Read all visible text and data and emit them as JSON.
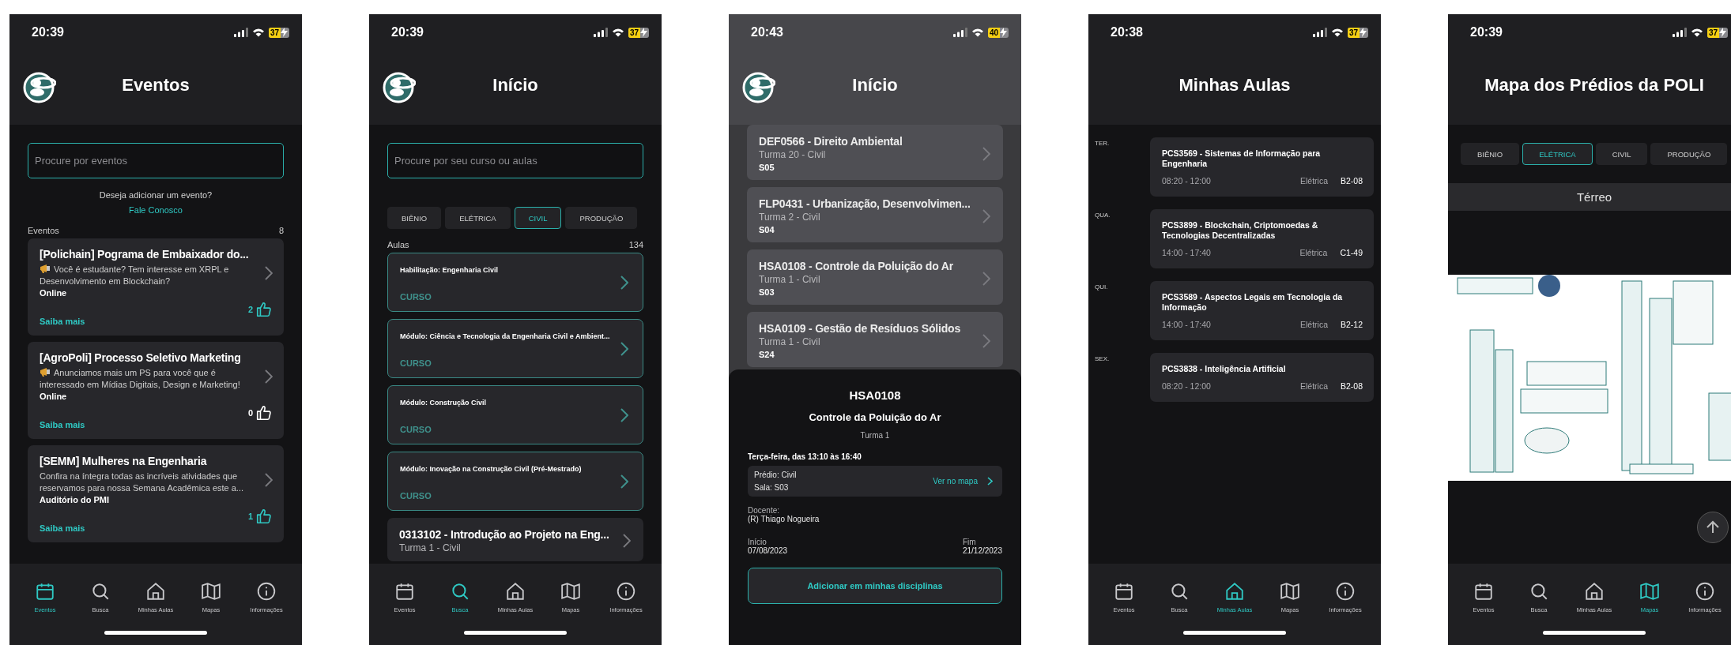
{
  "screens": [
    {
      "kind": "events",
      "status": {
        "time": "20:39",
        "battery": "37"
      },
      "title": "Eventos",
      "search": {
        "placeholder": "Procure por eventos"
      },
      "prompt": "Deseja adicionar um evento?",
      "contact_link": "Fale Conosco",
      "list_label": "Eventos",
      "count": "8",
      "events": [
        {
          "kind": "announcement",
          "title": "[Polichain] Pograma de Embaixador do...",
          "description": "Você é estudante? Tem interesse em XRPL e Desenvolvimento em Blockchain?",
          "location": "Online",
          "link": "Saiba mais",
          "likes": "2",
          "liked": true
        },
        {
          "kind": "announcement",
          "title": "[AgroPoli] Processo Seletivo Marketing",
          "description": "Anunciamos mais um PS para você que é interessado em Mídias Digitais, Design e Marketing!",
          "location": "Online",
          "link": "Saiba mais",
          "likes": "0",
          "liked": false
        },
        {
          "kind": "plain",
          "title": "[SEMM] Mulheres na Engenharia",
          "description": "Confira na íntegra todas as incríveis atividades que reservamos para nossa Semana Acadêmica este a...",
          "location": "Auditório do PMI",
          "link": "Saiba mais",
          "likes": "1",
          "liked": true
        }
      ],
      "tabs": [
        {
          "label": "Eventos",
          "selected": true
        },
        {
          "label": "Busca",
          "selected": false
        },
        {
          "label": "Minhas Aulas",
          "selected": false
        },
        {
          "label": "Mapas",
          "selected": false
        },
        {
          "label": "Informações",
          "selected": false
        }
      ]
    },
    {
      "kind": "search",
      "status": {
        "time": "20:39",
        "battery": "37"
      },
      "title": "Início",
      "search": {
        "placeholder": "Procure por seu curso ou aulas"
      },
      "chips": [
        {
          "label": "BIÊNIO",
          "selected": false
        },
        {
          "label": "ELÉTRICA",
          "selected": false
        },
        {
          "label": "CIVIL",
          "selected": true
        },
        {
          "label": "PRODUÇÃO",
          "selected": false
        }
      ],
      "list_label": "Aulas",
      "count": "134",
      "courses": [
        {
          "title": "Habilitação: Engenharia Civil",
          "tag": "CURSO"
        },
        {
          "title": "Módulo: Ciência e Tecnologia da Engenharia Civil e Ambient...",
          "tag": "CURSO"
        },
        {
          "title": "Módulo: Construção Civil",
          "tag": "CURSO"
        },
        {
          "title": "Módulo: Inovação na Construção Civil (Pré-Mestrado)",
          "tag": "CURSO"
        }
      ],
      "classes": [
        {
          "title": "0313102 - Introdução ao Projeto na Eng...",
          "subtitle": "Turma 1 - Civil"
        }
      ],
      "tabs": [
        {
          "label": "Eventos",
          "selected": false
        },
        {
          "label": "Busca",
          "selected": true
        },
        {
          "label": "Minhas Aulas",
          "selected": false
        },
        {
          "label": "Mapas",
          "selected": false
        },
        {
          "label": "Informações",
          "selected": false
        }
      ]
    },
    {
      "kind": "detail",
      "status": {
        "time": "20:43",
        "battery": "40"
      },
      "title": "Início",
      "classes": [
        {
          "title": "DEF0566 - Direito Ambiental",
          "subtitle": "Turma 20 - Civil",
          "room": "S05"
        },
        {
          "title": "FLP0431 - Urbanização, Desenvolvimen...",
          "subtitle": "Turma 2 - Civil",
          "room": "S04"
        },
        {
          "title": "HSA0108 - Controle da Poluição do Ar",
          "subtitle": "Turma 1 - Civil",
          "room": "S03"
        },
        {
          "title": "HSA0109 - Gestão de Resíduos Sólidos",
          "subtitle": "Turma 1 - Civil",
          "room": "S24"
        }
      ],
      "sheet": {
        "code": "HSA0108",
        "name": "Controle da Poluição do Ar",
        "group": "Turma 1",
        "schedule": "Terça-feira, das 13:10 às 16:40",
        "building": "Prédio: Civil",
        "room": "Sala: S03",
        "map_link": "Ver no mapa",
        "teacher_label": "Docente:",
        "teacher": "(R) Thiago Nogueira",
        "start_label": "Início",
        "start": "07/08/2023",
        "end_label": "Fim",
        "end": "21/12/2023",
        "button": "Adicionar em minhas disciplinas"
      }
    },
    {
      "kind": "schedule",
      "status": {
        "time": "20:38",
        "battery": "37"
      },
      "title": "Minhas Aulas",
      "days": [
        {
          "day": "TER.",
          "classes": [
            {
              "title": "PCS3569 - Sistemas de Informação para Engenharia",
              "time": "08:20 - 12:00",
              "building": "Elétrica",
              "room": "B2-08"
            }
          ]
        },
        {
          "day": "QUA.",
          "classes": [
            {
              "title": "PCS3899 - Blockchain, Criptomoedas & Tecnologias Decentralizadas",
              "time": "14:00 - 17:40",
              "building": "Elétrica",
              "room": "C1-49"
            }
          ]
        },
        {
          "day": "QUI.",
          "classes": [
            {
              "title": "PCS3589 - Aspectos Legais em Tecnologia da Informação",
              "time": "14:00 - 17:40",
              "building": "Elétrica",
              "room": "B2-12"
            }
          ]
        },
        {
          "day": "SEX.",
          "classes": [
            {
              "title": "PCS3838 - Inteligência Artificial",
              "time": "08:20 - 12:00",
              "building": "Elétrica",
              "room": "B2-08"
            }
          ]
        }
      ],
      "tabs": [
        {
          "label": "Eventos",
          "selected": false
        },
        {
          "label": "Busca",
          "selected": false
        },
        {
          "label": "Minhas Aulas",
          "selected": true
        },
        {
          "label": "Mapas",
          "selected": false
        },
        {
          "label": "Informações",
          "selected": false
        }
      ]
    },
    {
      "kind": "map",
      "status": {
        "time": "20:39",
        "battery": "37"
      },
      "title": "Mapa dos Prédios da POLI",
      "chips": [
        {
          "label": "BIÊNIO",
          "selected": false
        },
        {
          "label": "ELÉTRICA",
          "selected": true
        },
        {
          "label": "CIVIL",
          "selected": false
        },
        {
          "label": "PRODUÇÃO",
          "selected": false
        }
      ],
      "floor": "Térreo",
      "map": {
        "kind": "picture"
      },
      "tabs": [
        {
          "label": "Eventos",
          "selected": false
        },
        {
          "label": "Busca",
          "selected": false
        },
        {
          "label": "Minhas Aulas",
          "selected": false
        },
        {
          "label": "Mapas",
          "selected": true
        },
        {
          "label": "Informações",
          "selected": false
        }
      ]
    }
  ]
}
